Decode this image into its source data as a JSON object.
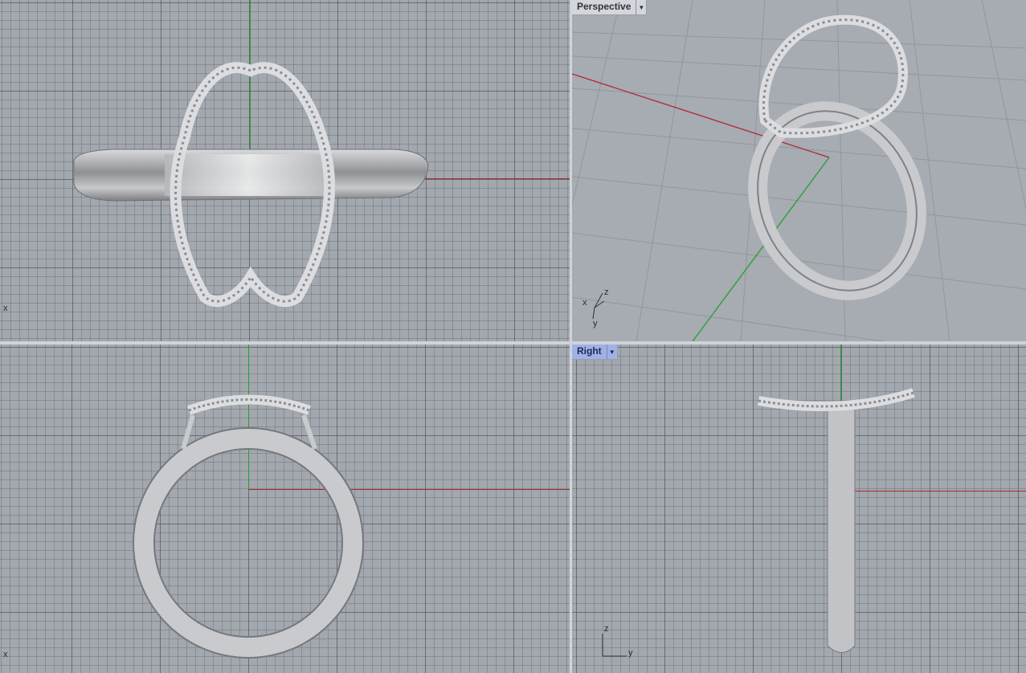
{
  "viewports": {
    "top": {
      "name": "",
      "axis_label": "x"
    },
    "perspective": {
      "name": "Perspective"
    },
    "front": {
      "name": "",
      "axis_label": "x"
    },
    "right": {
      "name": "Right",
      "gizmo_z": "z",
      "gizmo_y": "y"
    }
  },
  "gizmo_perspective": {
    "z": "z",
    "x": "x",
    "y": "y"
  },
  "colors": {
    "x_axis": "#b0282a",
    "y_axis": "#22a02a",
    "active_tab": "#9fb1e6",
    "metal_light": "#e4e5e7",
    "metal_dark": "#8e9094"
  },
  "icons": {
    "dropdown": "chevron-down-icon"
  }
}
